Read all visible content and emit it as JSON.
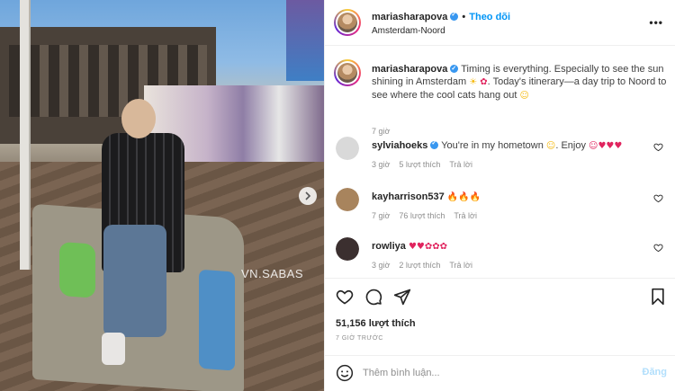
{
  "photo": {
    "watermark": "VN.SABAS"
  },
  "header": {
    "username": "mariasharapova",
    "separator": "•",
    "follow_label": "Theo dõi",
    "location": "Amsterdam-Noord",
    "more_icon": "ellipsis-icon"
  },
  "caption": {
    "username": "mariasharapova",
    "text_part1": "Timing is everything. Especially to see the sun shining in Amsterdam",
    "text_part2": ". Today's itinerary—a day trip to Noord to see where the cool cats hang out",
    "emoji_sun": "☀",
    "emoji_flower": "✿",
    "emoji_smile": "☺",
    "time": "7 giờ"
  },
  "comments": [
    {
      "username": "sylviahoeks",
      "verified": true,
      "text": "You're in my hometown",
      "emojis_mid": "☺",
      "text2": ". Enjoy",
      "emojis_end": "☺♥♥♥",
      "time": "3 giờ",
      "likes": "5 lượt thích",
      "reply": "Trả lời",
      "avatar_color": "#d9d9d9"
    },
    {
      "username": "kayharrison537",
      "verified": false,
      "text": "",
      "emojis_end": "🔥🔥🔥",
      "time": "7 giờ",
      "likes": "76 lượt thích",
      "reply": "Trả lời",
      "avatar_color": "#a8845d"
    },
    {
      "username": "rowliya",
      "verified": false,
      "text": "",
      "emojis_end": "♥♥✿✿✿",
      "time": "3 giờ",
      "likes": "2 lượt thích",
      "reply": "Trả lời",
      "avatar_color": "#3b2f2f"
    }
  ],
  "actions": {
    "like_icon": "heart-icon",
    "comment_icon": "comment-icon",
    "share_icon": "share-icon",
    "save_icon": "bookmark-icon",
    "likes_count": "51,156 lượt thích",
    "time_ago": "7 GIỜ TRƯỚC"
  },
  "comment_input": {
    "placeholder": "Thêm bình luận...",
    "post_label": "Đăng"
  },
  "colors": {
    "link_blue": "#0095f6",
    "post_disabled": "#b2dffc",
    "verified_blue": "#3897f0",
    "heart_red": "#e0245e"
  }
}
